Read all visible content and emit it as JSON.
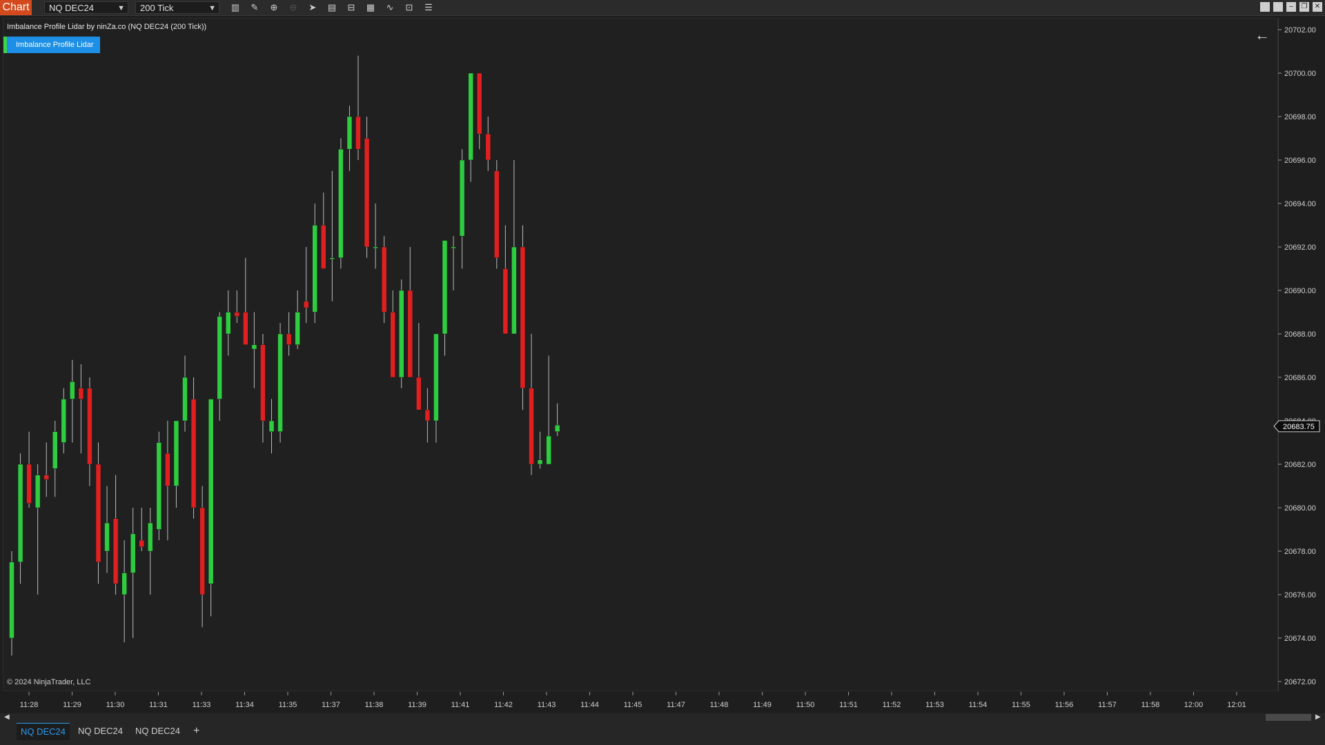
{
  "toolbar": {
    "chart_tab": "Chart",
    "instrument": "NQ DEC24",
    "interval": "200 Tick",
    "icons": [
      "bar-type-icon",
      "pencil-icon",
      "zoom-in-icon",
      "zoom-out-icon",
      "pointer-icon",
      "properties-icon",
      "templates-icon",
      "indicators-icon",
      "strategies-icon",
      "data-box-icon",
      "list-icon"
    ]
  },
  "chart": {
    "title": "Imbalance Profile Lidar by ninZa.co (NQ DEC24 (200 Tick))",
    "indicator_button": "Imbalance Profile Lidar",
    "copyright": "© 2024 NinjaTrader, LLC",
    "last_price": "20683.75",
    "colors": {
      "up": "#2ecc40",
      "down": "#e02020",
      "background": "#202020",
      "indicator": "#1e8fe6"
    }
  },
  "tabs": [
    {
      "label": "NQ DEC24",
      "active": true
    },
    {
      "label": "NQ DEC24",
      "active": false
    },
    {
      "label": "NQ DEC24",
      "active": false
    }
  ],
  "chart_data": {
    "type": "candlestick",
    "ylim": [
      20671.5,
      20703
    ],
    "y_ticks": [
      "20702.00",
      "20700.00",
      "20698.00",
      "20696.00",
      "20694.00",
      "20692.00",
      "20690.00",
      "20688.00",
      "20686.00",
      "20684.00",
      "20682.00",
      "20680.00",
      "20678.00",
      "20676.00",
      "20674.00",
      "20672.00"
    ],
    "x_ticks": [
      "11:28",
      "11:29",
      "11:30",
      "11:31",
      "11:33",
      "11:34",
      "11:35",
      "11:37",
      "11:38",
      "11:39",
      "11:41",
      "11:42",
      "11:43",
      "11:44",
      "11:45",
      "11:47",
      "11:48",
      "11:49",
      "11:50",
      "11:51",
      "11:52",
      "11:53",
      "11:54",
      "11:55",
      "11:56",
      "11:57",
      "11:58",
      "12:00",
      "12:01"
    ],
    "candles": [
      {
        "o": 20674.0,
        "h": 20678.0,
        "l": 20673.2,
        "c": 20677.5
      },
      {
        "o": 20677.5,
        "h": 20682.5,
        "l": 20676.5,
        "c": 20682.0
      },
      {
        "o": 20682.0,
        "h": 20683.5,
        "l": 20680.0,
        "c": 20680.2
      },
      {
        "o": 20680.0,
        "h": 20682.0,
        "l": 20676.0,
        "c": 20681.5
      },
      {
        "o": 20681.5,
        "h": 20683.0,
        "l": 20680.5,
        "c": 20681.3
      },
      {
        "o": 20681.8,
        "h": 20684.0,
        "l": 20680.5,
        "c": 20683.5
      },
      {
        "o": 20683.0,
        "h": 20685.5,
        "l": 20682.5,
        "c": 20685.0
      },
      {
        "o": 20685.0,
        "h": 20686.8,
        "l": 20683.0,
        "c": 20685.8
      },
      {
        "o": 20685.5,
        "h": 20686.6,
        "l": 20682.5,
        "c": 20685.0
      },
      {
        "o": 20685.5,
        "h": 20686.0,
        "l": 20681.0,
        "c": 20682.0
      },
      {
        "o": 20682.0,
        "h": 20683.0,
        "l": 20676.5,
        "c": 20677.5
      },
      {
        "o": 20678.0,
        "h": 20681.0,
        "l": 20677.0,
        "c": 20679.3
      },
      {
        "o": 20679.5,
        "h": 20681.5,
        "l": 20676.0,
        "c": 20676.5
      },
      {
        "o": 20676.0,
        "h": 20678.5,
        "l": 20673.8,
        "c": 20677.0
      },
      {
        "o": 20677.0,
        "h": 20680.0,
        "l": 20674.0,
        "c": 20678.8
      },
      {
        "o": 20678.5,
        "h": 20680.0,
        "l": 20678.0,
        "c": 20678.2
      },
      {
        "o": 20678.0,
        "h": 20680.0,
        "l": 20676.0,
        "c": 20679.3
      },
      {
        "o": 20679.0,
        "h": 20683.5,
        "l": 20678.5,
        "c": 20683.0
      },
      {
        "o": 20682.5,
        "h": 20684.0,
        "l": 20678.5,
        "c": 20681.0
      },
      {
        "o": 20681.0,
        "h": 20684.0,
        "l": 20680.0,
        "c": 20684.0
      },
      {
        "o": 20684.0,
        "h": 20687.0,
        "l": 20683.5,
        "c": 20686.0
      },
      {
        "o": 20685.0,
        "h": 20686.0,
        "l": 20679.5,
        "c": 20680.0
      },
      {
        "o": 20680.0,
        "h": 20681.0,
        "l": 20674.5,
        "c": 20676.0
      },
      {
        "o": 20676.5,
        "h": 20685.0,
        "l": 20675.0,
        "c": 20685.0
      },
      {
        "o": 20685.0,
        "h": 20689.0,
        "l": 20684.0,
        "c": 20688.8
      },
      {
        "o": 20688.0,
        "h": 20690.0,
        "l": 20687.0,
        "c": 20689.0
      },
      {
        "o": 20689.0,
        "h": 20690.0,
        "l": 20688.5,
        "c": 20688.8
      },
      {
        "o": 20689.0,
        "h": 20691.5,
        "l": 20687.5,
        "c": 20687.5
      },
      {
        "o": 20687.3,
        "h": 20689.0,
        "l": 20685.5,
        "c": 20687.5
      },
      {
        "o": 20687.5,
        "h": 20688.0,
        "l": 20683.0,
        "c": 20684.0
      },
      {
        "o": 20683.5,
        "h": 20685.0,
        "l": 20682.5,
        "c": 20684.0
      },
      {
        "o": 20683.5,
        "h": 20688.5,
        "l": 20683.0,
        "c": 20688.0
      },
      {
        "o": 20688.0,
        "h": 20689.0,
        "l": 20687.0,
        "c": 20687.5
      },
      {
        "o": 20687.5,
        "h": 20690.0,
        "l": 20687.3,
        "c": 20689.0
      },
      {
        "o": 20689.5,
        "h": 20692.0,
        "l": 20688.5,
        "c": 20689.2
      },
      {
        "o": 20689.0,
        "h": 20694.0,
        "l": 20688.5,
        "c": 20693.0
      },
      {
        "o": 20693.0,
        "h": 20694.5,
        "l": 20691.0,
        "c": 20691.0
      },
      {
        "o": 20691.5,
        "h": 20695.5,
        "l": 20689.5,
        "c": 20691.5
      },
      {
        "o": 20691.5,
        "h": 20697.0,
        "l": 20691.0,
        "c": 20696.5
      },
      {
        "o": 20696.5,
        "h": 20698.5,
        "l": 20695.5,
        "c": 20698.0
      },
      {
        "o": 20698.0,
        "h": 20700.8,
        "l": 20696.0,
        "c": 20696.5
      },
      {
        "o": 20697.0,
        "h": 20698.0,
        "l": 20691.5,
        "c": 20692.0
      },
      {
        "o": 20692.0,
        "h": 20694.0,
        "l": 20691.0,
        "c": 20692.0
      },
      {
        "o": 20692.0,
        "h": 20692.5,
        "l": 20688.5,
        "c": 20689.0
      },
      {
        "o": 20689.0,
        "h": 20690.0,
        "l": 20686.0,
        "c": 20686.0
      },
      {
        "o": 20686.0,
        "h": 20690.5,
        "l": 20685.5,
        "c": 20690.0
      },
      {
        "o": 20690.0,
        "h": 20692.0,
        "l": 20686.0,
        "c": 20686.0
      },
      {
        "o": 20686.0,
        "h": 20688.5,
        "l": 20684.5,
        "c": 20684.5
      },
      {
        "o": 20684.5,
        "h": 20685.5,
        "l": 20683.0,
        "c": 20684.0
      },
      {
        "o": 20684.0,
        "h": 20688.0,
        "l": 20683.0,
        "c": 20688.0
      },
      {
        "o": 20688.0,
        "h": 20692.0,
        "l": 20687.0,
        "c": 20692.3
      },
      {
        "o": 20692.0,
        "h": 20692.5,
        "l": 20690.0,
        "c": 20692.0
      },
      {
        "o": 20692.5,
        "h": 20696.5,
        "l": 20691.0,
        "c": 20696.0
      },
      {
        "o": 20696.0,
        "h": 20700.0,
        "l": 20695.0,
        "c": 20700.0
      },
      {
        "o": 20700.0,
        "h": 20700.0,
        "l": 20696.5,
        "c": 20697.2
      },
      {
        "o": 20697.2,
        "h": 20698.0,
        "l": 20695.5,
        "c": 20696.0
      },
      {
        "o": 20695.5,
        "h": 20696.0,
        "l": 20691.0,
        "c": 20691.5
      },
      {
        "o": 20691.0,
        "h": 20693.0,
        "l": 20688.5,
        "c": 20688.0
      },
      {
        "o": 20688.0,
        "h": 20696.0,
        "l": 20688.0,
        "c": 20692.0
      },
      {
        "o": 20692.0,
        "h": 20693.0,
        "l": 20684.5,
        "c": 20685.5
      },
      {
        "o": 20685.5,
        "h": 20688.0,
        "l": 20681.5,
        "c": 20682.0
      },
      {
        "o": 20682.0,
        "h": 20683.5,
        "l": 20681.8,
        "c": 20682.2
      },
      {
        "o": 20682.0,
        "h": 20687.0,
        "l": 20682.0,
        "c": 20683.3
      },
      {
        "o": 20683.5,
        "h": 20684.8,
        "l": 20683.3,
        "c": 20683.8
      }
    ]
  }
}
